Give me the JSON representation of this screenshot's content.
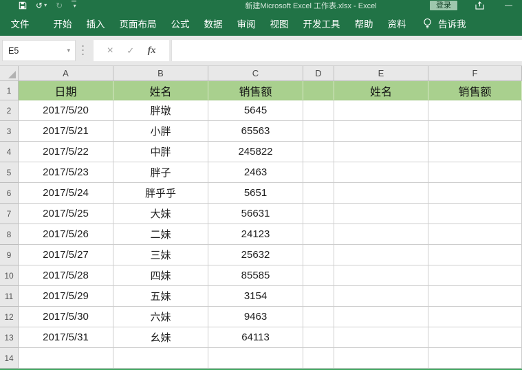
{
  "title_bar": {
    "title": "新建Microsoft Excel 工作表.xlsx  -  Excel",
    "login_label": "登录",
    "minimize_glyph": "—"
  },
  "quick_access": {
    "undo_glyph": "↺",
    "redo_glyph": "↻",
    "caret_glyph": "▾"
  },
  "ribbon": {
    "tabs": [
      "文件",
      "开始",
      "插入",
      "页面布局",
      "公式",
      "数据",
      "审阅",
      "视图",
      "开发工具",
      "帮助",
      "资料"
    ],
    "tell_me_label": "告诉我"
  },
  "formula_bar": {
    "name_box_value": "E5",
    "name_box_caret": "▾",
    "cancel_glyph": "×",
    "enter_glyph": "✓",
    "fx_glyph": "fx",
    "formula_value": ""
  },
  "grid": {
    "column_headers": [
      "A",
      "B",
      "C",
      "D",
      "E",
      "F"
    ],
    "row_numbers": [
      "1",
      "2",
      "3",
      "4",
      "5",
      "6",
      "7",
      "8",
      "9",
      "10",
      "11",
      "12",
      "13",
      "14"
    ],
    "header_row": [
      "日期",
      "姓名",
      "销售额",
      "",
      "姓名",
      "销售额"
    ],
    "rows": [
      [
        "2017/5/20",
        "胖墩",
        "5645"
      ],
      [
        "2017/5/21",
        "小胖",
        "65563"
      ],
      [
        "2017/5/22",
        "中胖",
        "245822"
      ],
      [
        "2017/5/23",
        "胖子",
        "2463"
      ],
      [
        "2017/5/24",
        "胖乎乎",
        "5651"
      ],
      [
        "2017/5/25",
        "大妹",
        "56631"
      ],
      [
        "2017/5/26",
        "二妹",
        "24123"
      ],
      [
        "2017/5/27",
        "三妹",
        "25632"
      ],
      [
        "2017/5/28",
        "四妹",
        "85585"
      ],
      [
        "2017/5/29",
        "五妹",
        "3154"
      ],
      [
        "2017/5/30",
        "六妹",
        "9463"
      ],
      [
        "2017/5/31",
        "幺妹",
        "64113"
      ]
    ]
  },
  "colors": {
    "ribbon_green": "#217346",
    "header_row_fill": "#A9D08E"
  }
}
